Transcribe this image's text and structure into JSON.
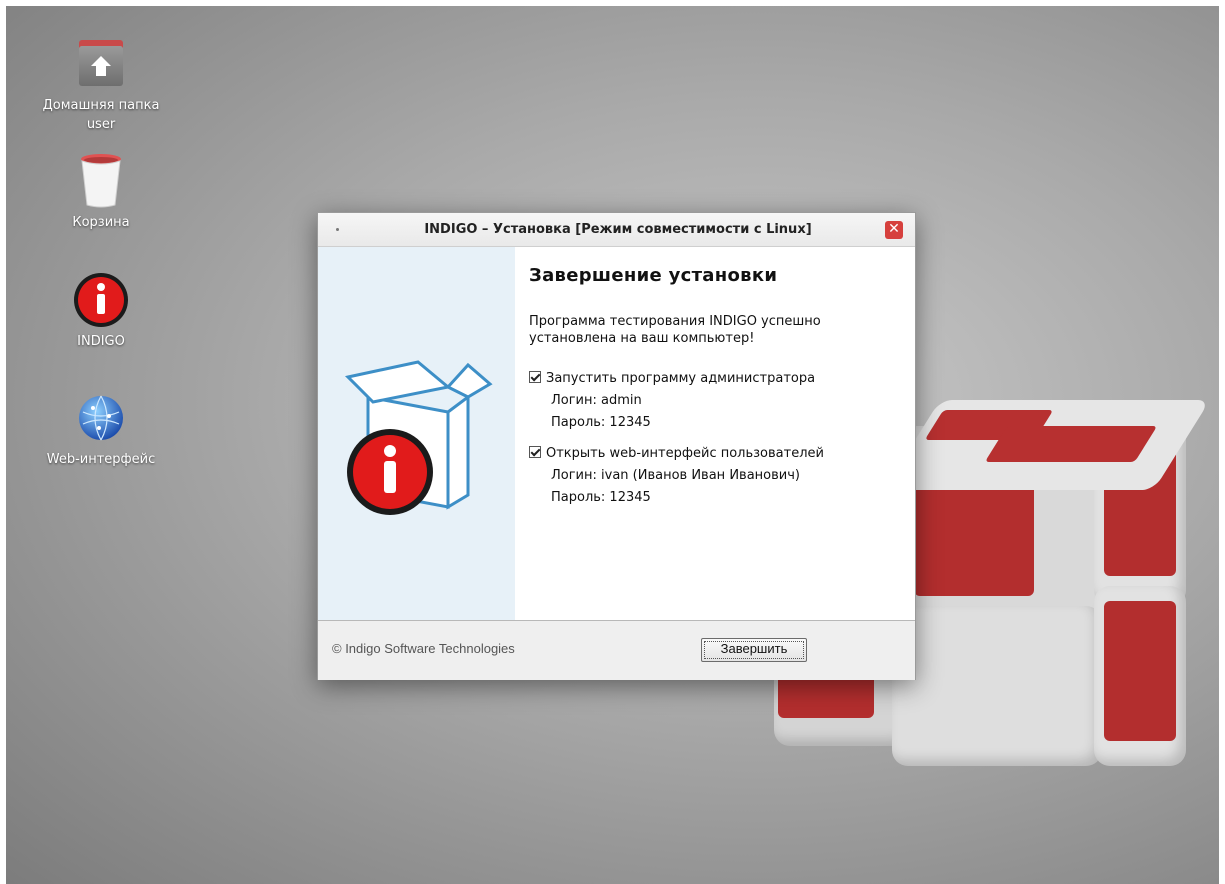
{
  "desktop": {
    "icons": [
      {
        "label": "Домашняя папка user",
        "icon": "home-folder-icon"
      },
      {
        "label": "Корзина",
        "icon": "trash-icon"
      },
      {
        "label": "INDIGO",
        "icon": "info-icon"
      },
      {
        "label": "Web-интерфейс",
        "icon": "globe-icon"
      }
    ]
  },
  "window": {
    "title": "INDIGO – Установка [Режим совместимости с Linux]",
    "close_glyph": "✕",
    "heading": "Завершение установки",
    "description": "Программа тестирования INDIGO успешно установлена на ваш компьютер!",
    "options": [
      {
        "label": "Запустить программу администратора",
        "checked": true,
        "login": "Логин: admin",
        "password": "Пароль: 12345"
      },
      {
        "label": "Открыть web-интерфейс пользователей",
        "checked": true,
        "login": "Логин: ivan (Иванов Иван Иванович)",
        "password": "Пароль: 12345"
      }
    ],
    "footer_text": "© Indigo Software Technologies",
    "finish_label": "Завершить"
  },
  "colors": {
    "accent_red": "#e11b1b",
    "box_blue": "#3d8fc7",
    "panel_blue": "#e7f1f8"
  }
}
